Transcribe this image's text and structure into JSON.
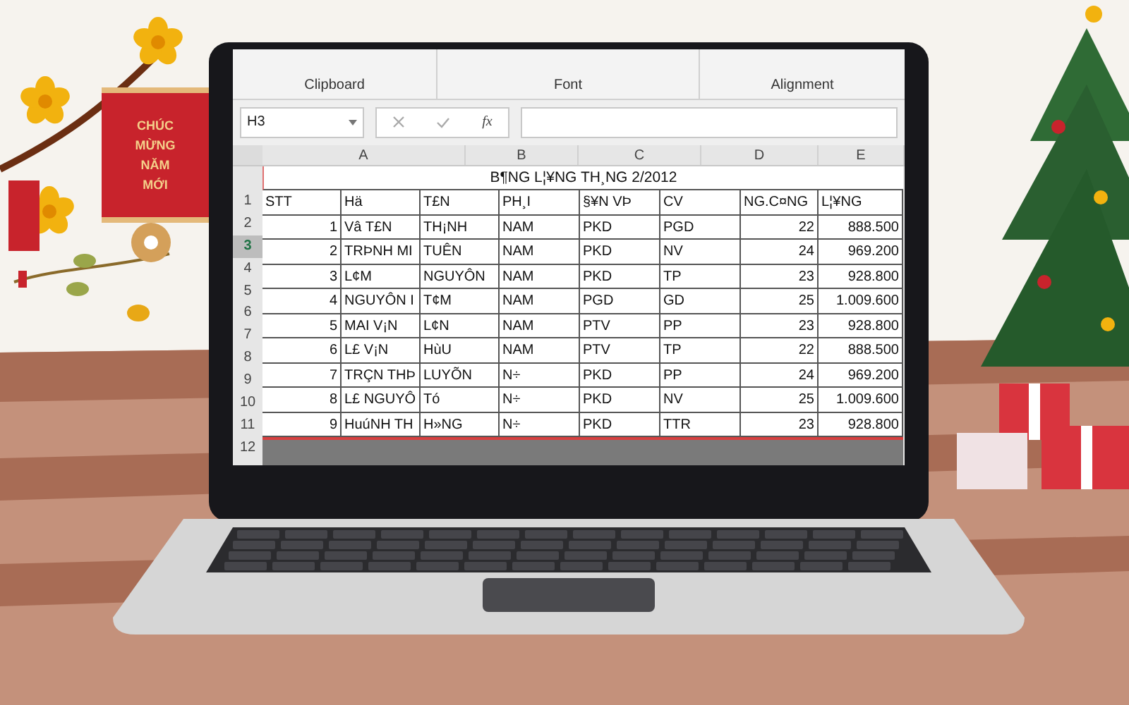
{
  "banner": {
    "lines": [
      "CHÚC",
      "MỪNG",
      "NĂM",
      "MỚI"
    ]
  },
  "ribbon": {
    "groups": [
      "Clipboard",
      "Font",
      "Alignment"
    ]
  },
  "formula_bar": {
    "name_box": "H3",
    "fx": "fx"
  },
  "column_letters": [
    "A",
    "B",
    "C",
    "D",
    "E"
  ],
  "sheet": {
    "title": "B¶NG L¦¥NG TH¸NG 2/2012",
    "row_headers": [
      {
        "label": "1",
        "selected": false
      },
      {
        "label": "2",
        "selected": false
      },
      {
        "label": "3",
        "selected": true
      },
      {
        "label": "4",
        "selected": false
      },
      {
        "label": "5",
        "selected": false
      },
      {
        "label": "6",
        "selected": false
      },
      {
        "label": "7",
        "selected": false
      },
      {
        "label": "8",
        "selected": false
      },
      {
        "label": "9",
        "selected": false
      },
      {
        "label": "10",
        "selected": false
      },
      {
        "label": "11",
        "selected": false
      },
      {
        "label": "12",
        "selected": false
      }
    ],
    "header": [
      "STT",
      "Hä",
      "T£N",
      "PH¸I",
      "§¥N VÞ",
      "CV",
      "NG.C¤NG",
      "L¦¥NG"
    ],
    "rows": [
      [
        "1",
        "Vâ T£N",
        "TH¡NH",
        "NAM",
        "PKD",
        "PGD",
        "22",
        "888.500"
      ],
      [
        "2",
        "TRÞNH MI",
        "TUÊN",
        "NAM",
        "PKD",
        "NV",
        "24",
        "969.200"
      ],
      [
        "3",
        "L¢M",
        "NGUYÔN",
        "NAM",
        "PKD",
        "TP",
        "23",
        "928.800"
      ],
      [
        "4",
        "NGUYÔN I",
        "T¢M",
        "NAM",
        "PGD",
        "GD",
        "25",
        "1.009.600"
      ],
      [
        "5",
        "MAI V¡N",
        "L¢N",
        "NAM",
        "PTV",
        "PP",
        "23",
        "928.800"
      ],
      [
        "6",
        "L£ V¡N",
        "HùU",
        "NAM",
        "PTV",
        "TP",
        "22",
        "888.500"
      ],
      [
        "7",
        "TRÇN THÞ",
        "LUYÕN",
        "N÷",
        "PKD",
        "PP",
        "24",
        "969.200"
      ],
      [
        "8",
        "L£ NGUYÔ",
        "Tó",
        "N÷",
        "PKD",
        "NV",
        "25",
        "1.009.600"
      ],
      [
        "9",
        "HuúNH TH",
        "H»NG",
        "N÷",
        "PKD",
        "TTR",
        "23",
        "928.800"
      ]
    ]
  }
}
